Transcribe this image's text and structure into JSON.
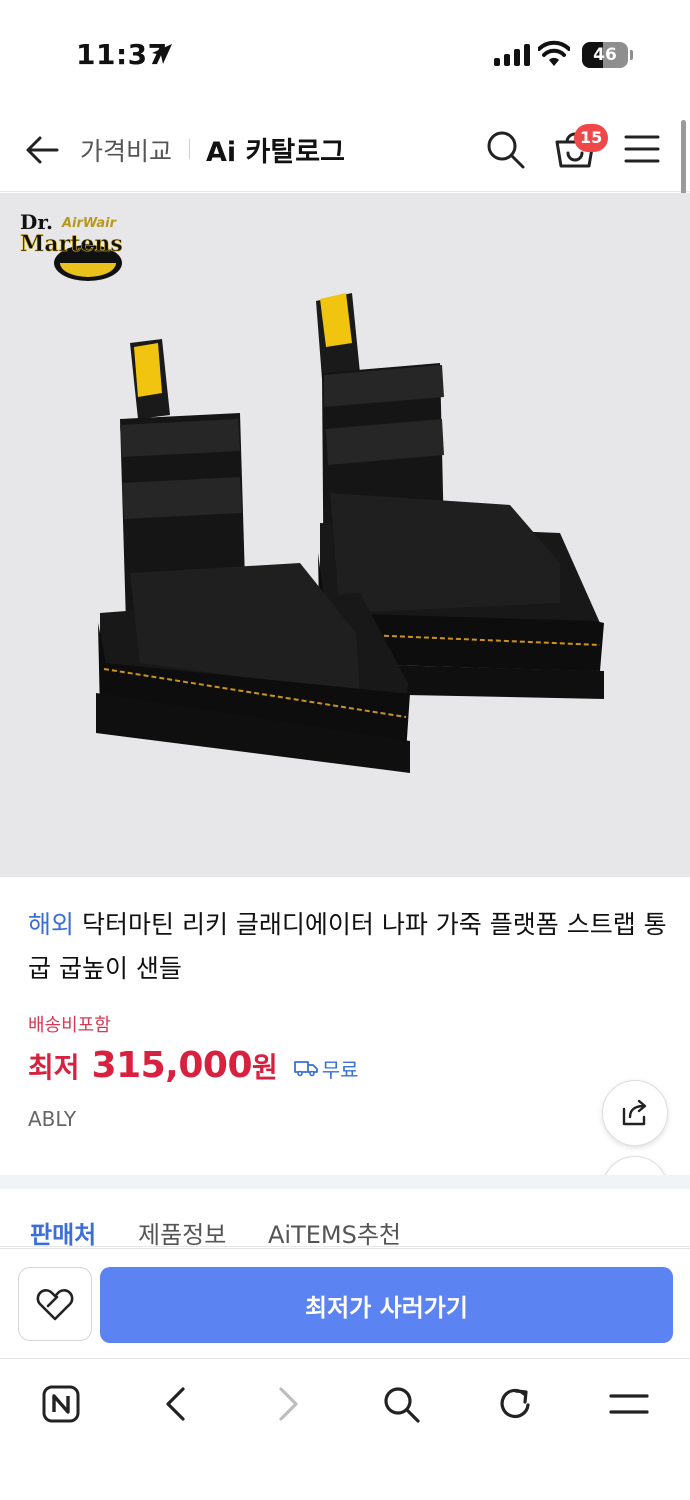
{
  "status_bar": {
    "time": "11:37",
    "battery_level": "46",
    "battery_fraction": 0.46
  },
  "header": {
    "back_icon": "arrow-left-icon",
    "breadcrumb": "가격비교",
    "title": "Ai 카탈로그",
    "search_icon": "search-icon",
    "cart_icon": "cart-icon",
    "cart_count": "15",
    "menu_icon": "hamburger-menu-icon"
  },
  "product_image": {
    "brand_logo": {
      "line1": "Dr.",
      "line2": "Martens",
      "tag": "AirWair"
    }
  },
  "product": {
    "tag": "해외",
    "title": "닥터마틴 리키 글래디에이터 나파 가죽 플랫폼 스트랩 통굽 굽높이 샌들",
    "shipping_note": "배송비포함",
    "price_prefix": "최저",
    "price": "315,000",
    "price_unit": "원",
    "shipping_fee": "무료",
    "seller": "ABLY",
    "accent_color": "#d8203f",
    "link_color": "#3b6fd6"
  },
  "floating": {
    "share_icon": "share-icon",
    "top_icon": "arrow-up-icon"
  },
  "tabs": [
    {
      "label": "판매처",
      "active": true
    },
    {
      "label": "제품정보",
      "active": false
    },
    {
      "label": "AiTEMS추천",
      "active": false
    }
  ],
  "action_bar": {
    "wish_icon": "heart-tag-icon",
    "buy_label": "최저가 사러가기",
    "buy_color": "#5c83f2"
  },
  "browser_bar": {
    "items": [
      "naver-home-icon",
      "back-icon",
      "forward-icon",
      "search-icon",
      "refresh-icon",
      "menu-icon"
    ]
  }
}
